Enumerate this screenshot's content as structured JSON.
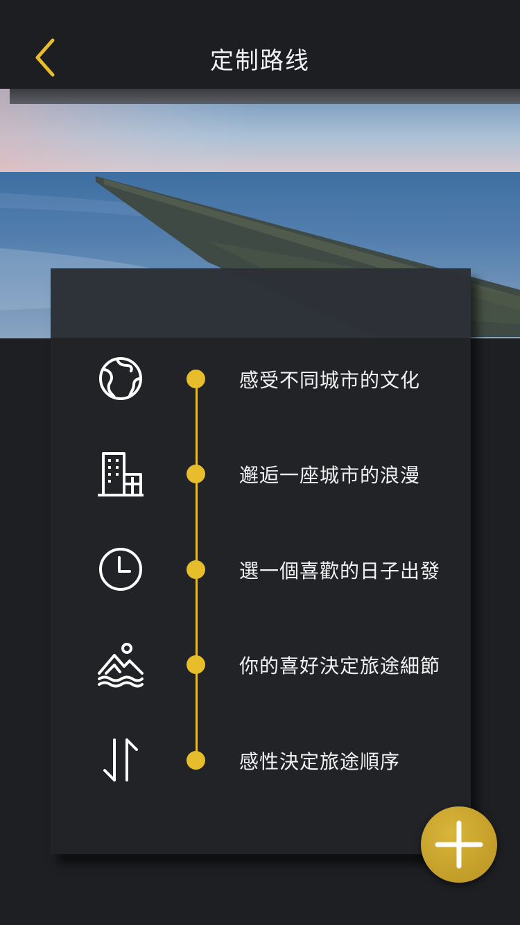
{
  "header": {
    "title": "定制路线",
    "back_icon": "chevron-left-icon"
  },
  "colors": {
    "accent": "#e8bd2b",
    "background": "#1e1f23",
    "card": "#212328",
    "text": "#f2f2f2"
  },
  "timeline": [
    {
      "icon": "globe-icon",
      "label": "感受不同城市的文化"
    },
    {
      "icon": "building-icon",
      "label": "邂逅一座城市的浪漫"
    },
    {
      "icon": "clock-icon",
      "label": "選一個喜歡的日子出發"
    },
    {
      "icon": "landscape-icon",
      "label": "你的喜好決定旅途細節"
    },
    {
      "icon": "swap-arrows-icon",
      "label": "感性決定旅途順序"
    }
  ],
  "fab": {
    "icon": "plus-icon"
  }
}
